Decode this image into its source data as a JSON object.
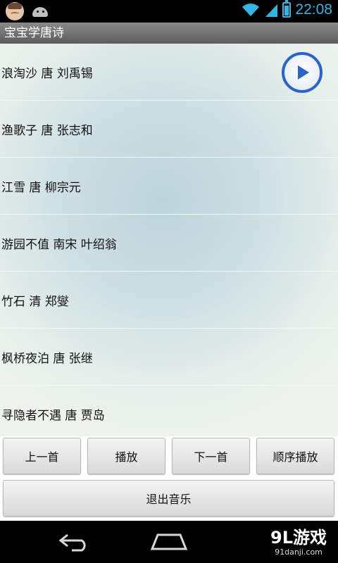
{
  "status_bar": {
    "time": "22:08",
    "icons": [
      "baby-avatar-icon",
      "android-icon",
      "wifi-icon",
      "signal-icon",
      "battery-icon"
    ]
  },
  "app": {
    "title": "宝宝学唐诗"
  },
  "poems": [
    "浪淘沙 唐 刘禹锡",
    "渔歌子 唐 张志和",
    "江雪 唐 柳宗元",
    "游园不值 南宋 叶绍翁",
    "竹石 清 郑燮",
    "枫桥夜泊 唐 张继",
    "寻隐者不遇 唐 贾岛"
  ],
  "controls": {
    "prev_label": "上一首",
    "play_label": "播放",
    "next_label": "下一首",
    "order_label": "顺序播放",
    "exit_label": "退出音乐"
  },
  "watermark": {
    "main": "9L游戏",
    "sub": "91danji.com"
  },
  "colors": {
    "status_accent": "#33b5e5",
    "play_button": "#2a63c9",
    "title_bar": "#6e6e6e"
  }
}
